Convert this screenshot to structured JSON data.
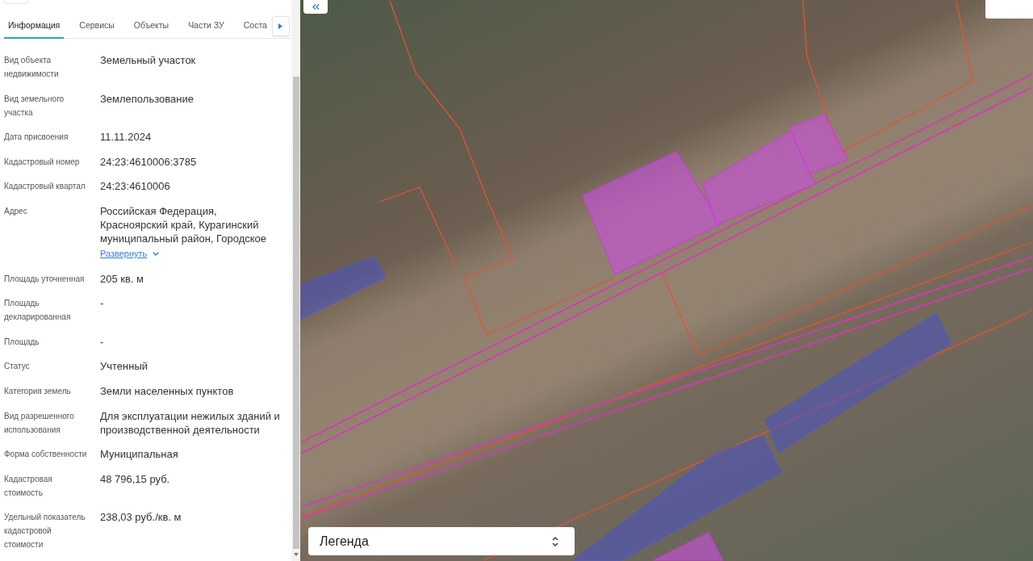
{
  "panel": {
    "tabs": [
      {
        "label": "Информация",
        "selected": true
      },
      {
        "label": "Сервисы",
        "selected": false
      },
      {
        "label": "Объекты",
        "selected": false
      },
      {
        "label": "Части ЗУ",
        "selected": false
      },
      {
        "label": "Соста",
        "selected": false
      }
    ],
    "fields": [
      {
        "label": "Вид объекта недвижимости",
        "value": "Земельный участок"
      },
      {
        "label": "Вид земельного участка",
        "value": "Землепользование"
      },
      {
        "label": "Дата присвоения",
        "value": "11.11.2024"
      },
      {
        "label": "Кадастровый номер",
        "value": "24:23:4610006:3785"
      },
      {
        "label": "Кадастровый квартал",
        "value": "24:23:4610006"
      },
      {
        "label": "Адрес",
        "value": "Российская Федерация, Красноярский край, Курагинский муниципальный район, Городское",
        "link": "Развернуть"
      },
      {
        "label": "Площадь уточненная",
        "value": "205 кв. м"
      },
      {
        "label": "Площадь декларированная",
        "value": "-"
      },
      {
        "label": "Площадь",
        "value": "-"
      },
      {
        "label": "Статус",
        "value": "Учтенный"
      },
      {
        "label": "Категория земель",
        "value": "Земли населенных пунктов"
      },
      {
        "label": "Вид разрешенного использования",
        "value": "Для эксплуатации нежилых зданий и производственной деятельности"
      },
      {
        "label": "Форма собственности",
        "value": "Муниципальная"
      },
      {
        "label": "Кадастровая стоимость",
        "value": "48 796,15 руб."
      },
      {
        "label": "Удельный показатель кадастровой стоимости",
        "value": "238,03 руб./кв. м"
      }
    ]
  },
  "map": {
    "legend": {
      "label": "Легенда"
    }
  }
}
